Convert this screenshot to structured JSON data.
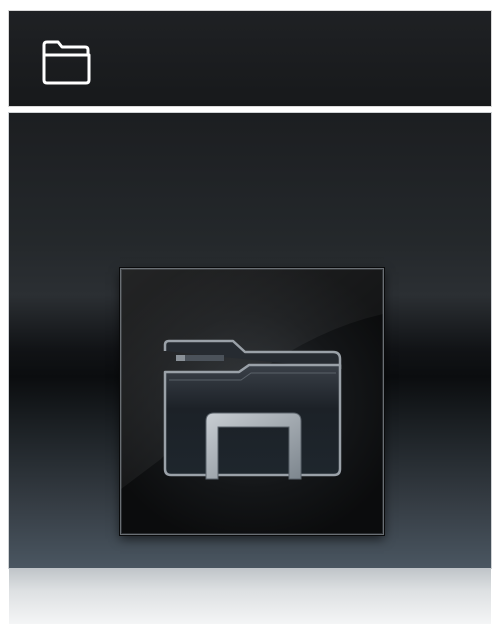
{
  "tiles": [
    {
      "name": "banner-tile",
      "icon": "folder-outline-icon"
    },
    {
      "name": "explorer-tile",
      "icon": "file-explorer-icon"
    }
  ]
}
